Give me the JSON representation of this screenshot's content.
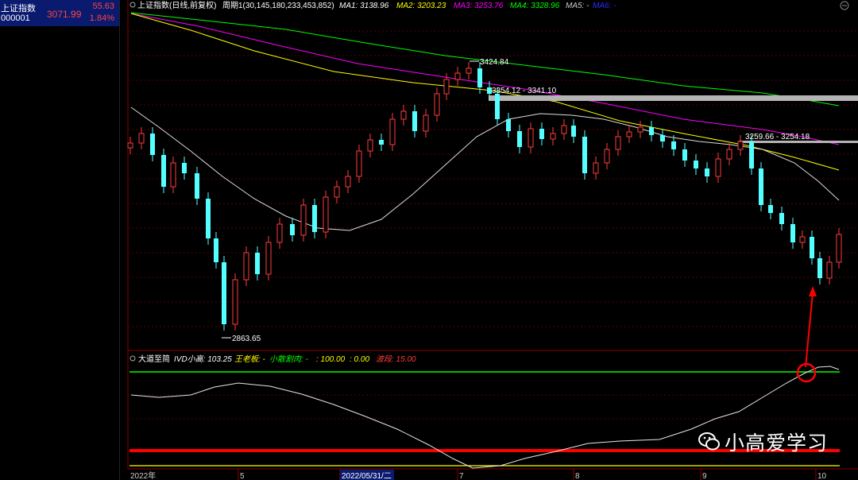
{
  "sidebar": {
    "name": "上证指数",
    "code": "000001",
    "price": "3071.99",
    "change": "55.63",
    "change_pct": "1.84%"
  },
  "header": {
    "title": "上证指数(日线,前复权)",
    "period": "周期1(30,145,180,233,453,852)",
    "ma1": "MA1: 3138.96",
    "ma2": "MA2: 3203.23",
    "ma3": "MA3: 3253.76",
    "ma4": "MA4: 3328.96",
    "ma5": "MA5: -",
    "ma6": "MA6: -"
  },
  "annotations": {
    "high": "3424.84",
    "low": "2863.65",
    "range1": "3354.12 - 3341.10",
    "range2": "3259.66 - 3254.18"
  },
  "indicator": {
    "name": "大道至简",
    "ivd": "IVD小高: 103.25",
    "wang": "王老板: -",
    "xiaoqiang": "小散割肉: -",
    "v100": ": 100.00",
    "v0": ": 0.00",
    "boduan": "波段: 15.00"
  },
  "xaxis": {
    "labels": [
      "2022年",
      "5",
      "2022/05/31/二",
      "7",
      "8",
      "9",
      "10"
    ]
  },
  "watermark": {
    "text": "小高爱学习"
  },
  "colors": {
    "up": "#ff3c3c",
    "down": "#54ffff",
    "ma1": "#e6e6e6",
    "ma2": "#ffff00",
    "ma3": "#ff00ff",
    "ma4": "#00ff00",
    "accent_red": "#ff0000",
    "header_bg": "#0a1a6e"
  }
}
